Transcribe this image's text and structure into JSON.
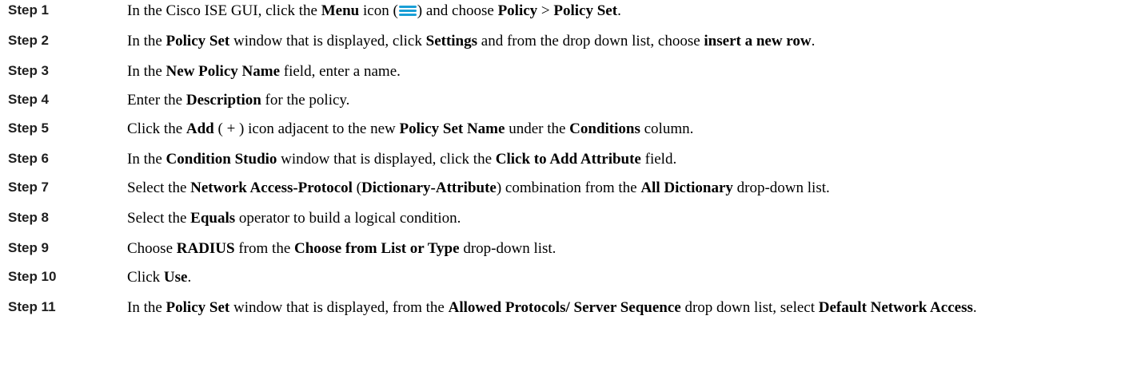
{
  "steps": [
    {
      "label": "Step 1",
      "parts": [
        {
          "t": "In the Cisco ISE GUI, click the "
        },
        {
          "b": "Menu"
        },
        {
          "t": " icon ("
        },
        {
          "icon": "menu-icon"
        },
        {
          "t": ") and choose "
        },
        {
          "b": "Policy"
        },
        {
          "t": " > "
        },
        {
          "b": "Policy Set"
        },
        {
          "t": "."
        }
      ]
    },
    {
      "label": "Step 2",
      "parts": [
        {
          "t": "In the "
        },
        {
          "b": "Policy Set"
        },
        {
          "t": " window that is displayed, click "
        },
        {
          "b": "Settings"
        },
        {
          "t": " and from the drop down list, choose "
        },
        {
          "b": "insert a new row"
        },
        {
          "t": "."
        }
      ]
    },
    {
      "label": "Step 3",
      "parts": [
        {
          "t": "In the "
        },
        {
          "b": "New Policy Name"
        },
        {
          "t": " field, enter a name."
        }
      ]
    },
    {
      "label": "Step 4",
      "parts": [
        {
          "t": "Enter the "
        },
        {
          "b": "Description"
        },
        {
          "t": " for the policy."
        }
      ]
    },
    {
      "label": "Step 5",
      "parts": [
        {
          "t": "Click the "
        },
        {
          "b": "Add"
        },
        {
          "t": " ( + ) icon adjacent to the new "
        },
        {
          "b": "Policy Set Name"
        },
        {
          "t": " under the "
        },
        {
          "b": "Conditions"
        },
        {
          "t": " column."
        }
      ]
    },
    {
      "label": "Step 6",
      "parts": [
        {
          "t": "In the "
        },
        {
          "b": "Condition Studio"
        },
        {
          "t": " window that is displayed, click the "
        },
        {
          "b": "Click to Add Attribute"
        },
        {
          "t": " field."
        }
      ]
    },
    {
      "label": "Step 7",
      "parts": [
        {
          "t": "Select the "
        },
        {
          "b": "Network Access-Protocol"
        },
        {
          "t": " ("
        },
        {
          "b": "Dictionary-Attribute"
        },
        {
          "t": ") combination from the "
        },
        {
          "b": "All Dictionary"
        },
        {
          "t": " drop-down list."
        }
      ]
    },
    {
      "label": "Step 8",
      "parts": [
        {
          "t": "Select the "
        },
        {
          "b": "Equals"
        },
        {
          "t": " operator to build a logical condition."
        }
      ]
    },
    {
      "label": "Step 9",
      "parts": [
        {
          "t": "Choose "
        },
        {
          "b": "RADIUS"
        },
        {
          "t": " from the "
        },
        {
          "b": "Choose from List or Type"
        },
        {
          "t": " drop-down list."
        }
      ]
    },
    {
      "label": "Step 10",
      "parts": [
        {
          "t": "Click "
        },
        {
          "b": "Use"
        },
        {
          "t": "."
        }
      ]
    },
    {
      "label": "Step 11",
      "parts": [
        {
          "t": "In the "
        },
        {
          "b": "Policy Set"
        },
        {
          "t": " window that is displayed, from the "
        },
        {
          "b": "Allowed Protocols/ Server Sequence"
        },
        {
          "t": " drop down list, select "
        },
        {
          "b": "Default Network Access"
        },
        {
          "t": "."
        }
      ]
    }
  ],
  "colors": {
    "menu_icon": "#1a9fd6"
  }
}
